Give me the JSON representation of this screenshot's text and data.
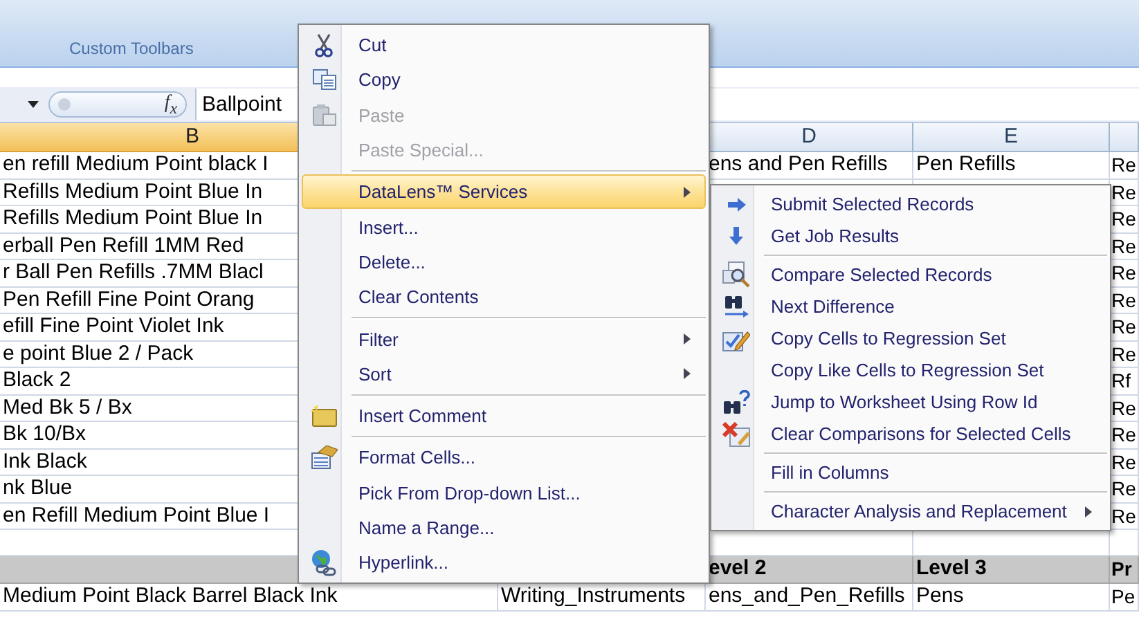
{
  "ribbon": {
    "group_label": "Custom Toolbars"
  },
  "formula_bar": {
    "function_label": "f$_{x}$",
    "value": "Ballpoint"
  },
  "sheet": {
    "headers": [
      {
        "label": "B",
        "selected": true
      },
      {
        "label": "D",
        "selected": false
      },
      {
        "label": "E",
        "selected": false
      }
    ],
    "rows": [
      {
        "kind": "data",
        "B": "en refill Medium Point black I",
        "D": "ens and Pen Refills",
        "E": "Pen Refills",
        "F": "Re"
      },
      {
        "kind": "data",
        "B": "Refills Medium Point Blue In",
        "F": "Re"
      },
      {
        "kind": "data",
        "B": "Refills Medium Point Blue In",
        "F": "Re"
      },
      {
        "kind": "data",
        "B": "erball Pen Refill 1MM Red",
        "F": "Re"
      },
      {
        "kind": "data",
        "B": "r Ball Pen Refills .7MM Blacl",
        "F": "Re"
      },
      {
        "kind": "data",
        "B": "Pen Refill Fine Point Orang",
        "F": "Re"
      },
      {
        "kind": "data",
        "B": "efill Fine Point Violet Ink",
        "F": "Re"
      },
      {
        "kind": "data",
        "B": "e point Blue 2 / Pack",
        "F": "Re"
      },
      {
        "kind": "data",
        "B": "Black 2",
        "F": "Rf"
      },
      {
        "kind": "data",
        "B": "Med Bk 5 / Bx",
        "F": "Re"
      },
      {
        "kind": "data",
        "B": "Bk 10/Bx",
        "F": "Re"
      },
      {
        "kind": "data",
        "B": "Ink Black",
        "F": "Re"
      },
      {
        "kind": "data",
        "B": "nk Blue",
        "F": "Re"
      },
      {
        "kind": "data",
        "B": "en Refill Medium Point Blue I",
        "F": "Re"
      },
      {
        "kind": "blank"
      },
      {
        "kind": "heading",
        "D": "evel 2",
        "E": "Level 3",
        "F": "Pr"
      },
      {
        "kind": "data",
        "B": "Medium Point Black Barrel Black Ink",
        "C": "Writing_Instruments",
        "D": "ens_and_Pen_Refills",
        "E": "Pens",
        "F": "Pe"
      }
    ]
  },
  "context_menu": {
    "items": [
      {
        "kind": "command",
        "label": "Cut",
        "disabled": false,
        "selected": false,
        "has_submenu": false
      },
      {
        "kind": "command",
        "label": "Copy",
        "disabled": false,
        "selected": false,
        "has_submenu": false
      },
      {
        "kind": "command",
        "label": "Paste",
        "disabled": true,
        "selected": false,
        "has_submenu": false
      },
      {
        "kind": "command",
        "label": "Paste Special...",
        "disabled": true,
        "selected": false,
        "has_submenu": false
      },
      {
        "kind": "separator"
      },
      {
        "kind": "command",
        "label": "DataLens™ Services",
        "disabled": false,
        "selected": true,
        "has_submenu": true
      },
      {
        "kind": "command",
        "label": "Insert...",
        "disabled": false,
        "selected": false,
        "has_submenu": false
      },
      {
        "kind": "command",
        "label": "Delete...",
        "disabled": false,
        "selected": false,
        "has_submenu": false
      },
      {
        "kind": "command",
        "label": "Clear Contents",
        "disabled": false,
        "selected": false,
        "has_submenu": false
      },
      {
        "kind": "separator"
      },
      {
        "kind": "command",
        "label": "Filter",
        "disabled": false,
        "selected": false,
        "has_submenu": true
      },
      {
        "kind": "command",
        "label": "Sort",
        "disabled": false,
        "selected": false,
        "has_submenu": true
      },
      {
        "kind": "separator"
      },
      {
        "kind": "command",
        "label": "Insert Comment",
        "disabled": false,
        "selected": false,
        "has_submenu": false
      },
      {
        "kind": "separator"
      },
      {
        "kind": "command",
        "label": "Format Cells...",
        "disabled": false,
        "selected": false,
        "has_submenu": false
      },
      {
        "kind": "command",
        "label": "Pick From Drop-down List...",
        "disabled": false,
        "selected": false,
        "has_submenu": false
      },
      {
        "kind": "command",
        "label": "Name a Range...",
        "disabled": false,
        "selected": false,
        "has_submenu": false
      },
      {
        "kind": "command",
        "label": "Hyperlink...",
        "disabled": false,
        "selected": false,
        "has_submenu": false
      }
    ]
  },
  "submenu": {
    "items": [
      {
        "kind": "command",
        "label": "Submit Selected Records",
        "has_submenu": false
      },
      {
        "kind": "command",
        "label": "Get Job Results",
        "has_submenu": false
      },
      {
        "kind": "separator"
      },
      {
        "kind": "command",
        "label": "Compare Selected Records",
        "has_submenu": false
      },
      {
        "kind": "command",
        "label": "Next Difference",
        "has_submenu": false
      },
      {
        "kind": "command",
        "label": "Copy Cells to Regression Set",
        "has_submenu": false
      },
      {
        "kind": "command",
        "label": "Copy Like Cells to Regression Set",
        "has_submenu": false
      },
      {
        "kind": "command",
        "label": "Jump to Worksheet Using Row Id",
        "has_submenu": false
      },
      {
        "kind": "command",
        "label": "Clear Comparisons for Selected Cells",
        "has_submenu": false
      },
      {
        "kind": "separator"
      },
      {
        "kind": "command",
        "label": "Fill in Columns",
        "has_submenu": false
      },
      {
        "kind": "separator"
      },
      {
        "kind": "command",
        "label": "Character Analysis and Replacement",
        "has_submenu": true
      }
    ]
  }
}
